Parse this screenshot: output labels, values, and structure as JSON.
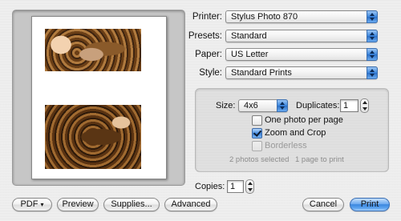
{
  "preview": {
    "photo1": "photo-leopard-costume-baby",
    "photo2": "photo-leopard-costume-baby-rotated"
  },
  "printer": {
    "label": "Printer:",
    "value": "Stylus Photo 870"
  },
  "presets": {
    "label": "Presets:",
    "value": "Standard"
  },
  "paper": {
    "label": "Paper:",
    "value": "US Letter"
  },
  "style": {
    "label": "Style:",
    "value": "Standard Prints"
  },
  "options": {
    "size_label": "Size:",
    "size_value": "4x6",
    "duplicates_label": "Duplicates:",
    "duplicates_value": "1",
    "one_photo_label": "One photo per page",
    "one_photo_checked": false,
    "zoom_crop_label": "Zoom and Crop",
    "zoom_crop_checked": true,
    "borderless_label": "Borderless",
    "borderless_enabled": false,
    "photos_selected": "2 photos selected",
    "pages_to_print": "1 page to print"
  },
  "copies": {
    "label": "Copies:",
    "value": "1"
  },
  "buttons": {
    "pdf": "PDF",
    "pdf_arrow": "▾",
    "preview": "Preview",
    "supplies": "Supplies...",
    "advanced": "Advanced",
    "cancel": "Cancel",
    "print": "Print"
  },
  "colors": {
    "accent": "#3a86de",
    "background": "#ececec"
  }
}
